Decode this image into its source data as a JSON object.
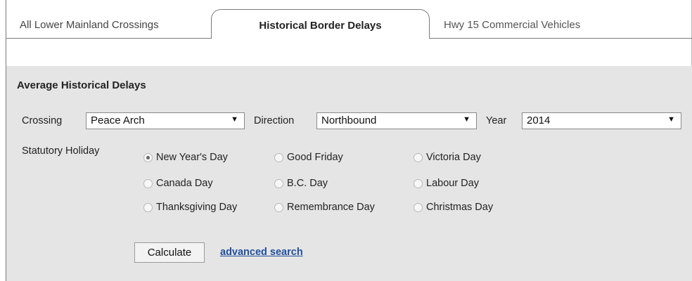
{
  "tabs": [
    {
      "label": "All Lower Mainland Crossings"
    },
    {
      "label": "Historical Border Delays",
      "active": true
    },
    {
      "label": "Hwy 15 Commercial Vehicles"
    }
  ],
  "form": {
    "title": "Average Historical Delays",
    "crossing": {
      "label": "Crossing",
      "value": "Peace Arch"
    },
    "direction": {
      "label": "Direction",
      "value": "Northbound"
    },
    "year": {
      "label": "Year",
      "value": "2014"
    },
    "holiday": {
      "label": "Statutory Holiday",
      "selected": "New Year's Day",
      "options": [
        "New Year's Day",
        "Good Friday",
        "Victoria Day",
        "Canada Day",
        "B.C. Day",
        "Labour Day",
        "Thanksgiving Day",
        "Remembrance Day",
        "Christmas Day"
      ]
    },
    "calculate_label": "Calculate",
    "advanced_link": "advanced search"
  },
  "icons": {
    "dropdown": "dropdown-arrow-icon",
    "radio": "radio-button-icon"
  },
  "colors": {
    "panel_bg": "#e5e5e5",
    "link": "#1f4f9c",
    "border": "#7a7a7a"
  }
}
